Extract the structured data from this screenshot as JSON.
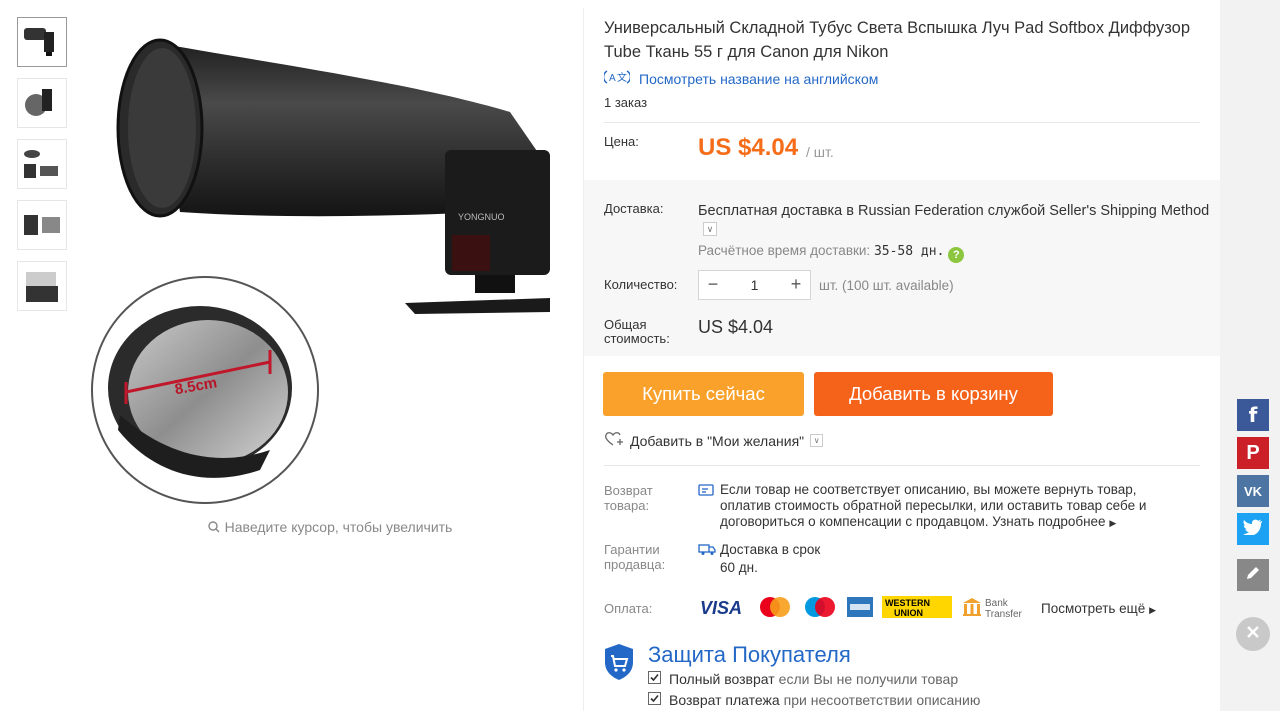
{
  "product": {
    "title": "Универсальный Складной Тубус Света Вспышка Луч Pad Softbox Диффузор Tube Ткань 55 г для Canon для Nikon",
    "translate_link": "Посмотреть название на английском",
    "orders": "1 заказ"
  },
  "gallery": {
    "zoom_hint": "Наведите курсор, чтобы увеличить",
    "image_callout": "8.5cm",
    "flash_brand": "YONGNUO"
  },
  "price": {
    "label": "Цена:",
    "value": "US $4.04",
    "unit": "/ шт."
  },
  "shipping": {
    "label": "Доставка:",
    "text_prefix": "Бесплатная доставка в ",
    "country": "Russian Federation",
    "text_mid": " службой ",
    "method": "Seller's Shipping Method",
    "eta_label": "Расчётное время доставки:",
    "eta_value": "35-58 дн.",
    "help_icon_label": "?"
  },
  "quantity": {
    "label": "Количество:",
    "value": "1",
    "minus": "−",
    "plus": "+",
    "available": "шт. (100 шт. available)"
  },
  "total": {
    "label": "Общая стоимость:",
    "value": "US $4.04"
  },
  "actions": {
    "buy_now": "Купить сейчас",
    "add_to_cart": "Добавить в корзину",
    "wishlist": "Добавить в \"Мои желания\""
  },
  "returns": {
    "label": "Возврат товара:",
    "text": "Если товар не соответствует описанию, вы можете вернуть товар, оплатив стоимость обратной пересылки, или оставить товар себе и договориться о компенсации с продавцом. ",
    "more": "Узнать подробнее"
  },
  "guarantee": {
    "label": "Гарантии продавца:",
    "line1": "Доставка в срок",
    "line2": "60 дн."
  },
  "payment": {
    "label": "Оплата:",
    "methods": [
      "VISA",
      "MasterCard",
      "Maestro",
      "American Express",
      "WESTERN UNION",
      "Bank Transfer"
    ],
    "visa": "VISA",
    "western_line1": "WESTERN",
    "western_line2": "UNION",
    "bank_line1": "Bank",
    "bank_line2": "Transfer",
    "more": "Посмотреть ещё"
  },
  "protection": {
    "title": "Защита Покупателя",
    "item1_strong": "Полный возврат",
    "item1_rest": "если Вы не получили товар",
    "item2_strong": "Возврат платежа",
    "item2_rest": "при несоответствии описанию"
  },
  "social": {
    "facebook": "f",
    "pinterest": "P",
    "vk": "VK"
  },
  "colors": {
    "accent_orange": "#f56d19",
    "buy_button": "#f9a12a",
    "cart_button": "#f5621a",
    "link_blue": "#2468c7"
  }
}
